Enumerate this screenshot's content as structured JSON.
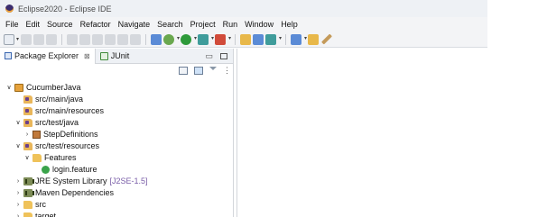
{
  "window": {
    "title": "Eclipse2020 - Eclipse IDE"
  },
  "menu": [
    "File",
    "Edit",
    "Source",
    "Refactor",
    "Navigate",
    "Search",
    "Project",
    "Run",
    "Window",
    "Help"
  ],
  "view": {
    "tabs": [
      {
        "label": "Package Explorer",
        "close": "⊠"
      },
      {
        "label": "JUnit"
      }
    ]
  },
  "tree": {
    "project": "CucumberJava",
    "src_main_java": "src/main/java",
    "src_main_resources": "src/main/resources",
    "src_test_java": "src/test/java",
    "step_definitions": "StepDefinitions",
    "src_test_resources": "src/test/resources",
    "features": "Features",
    "login_feature": "login.feature",
    "jre_library": "JRE System Library",
    "jre_qualifier": "[J2SE-1.5]",
    "maven_deps": "Maven Dependencies",
    "src": "src",
    "target": "target"
  },
  "icons": {
    "toolbar": [
      "new-icon",
      "save-icon",
      "print-icon",
      "debug-skip-icon",
      "resume-icon",
      "suspend-icon",
      "terminate-icon",
      "step-into-icon",
      "step-over-icon",
      "step-return-icon",
      "perspective-icon",
      "debug-icon",
      "run-icon",
      "coverage-icon",
      "external-tools-icon",
      "new-package-icon",
      "new-class-icon",
      "search-icon",
      "open-type-icon",
      "folder-icon",
      "pencil-icon"
    ],
    "tree": [
      "project-icon",
      "source-folder-icon",
      "package-icon",
      "folder-icon",
      "feature-file-icon",
      "library-icon"
    ]
  },
  "colors": {
    "jre_qualifier": "#7a5ea8",
    "chrome": "#f3f4f6"
  }
}
